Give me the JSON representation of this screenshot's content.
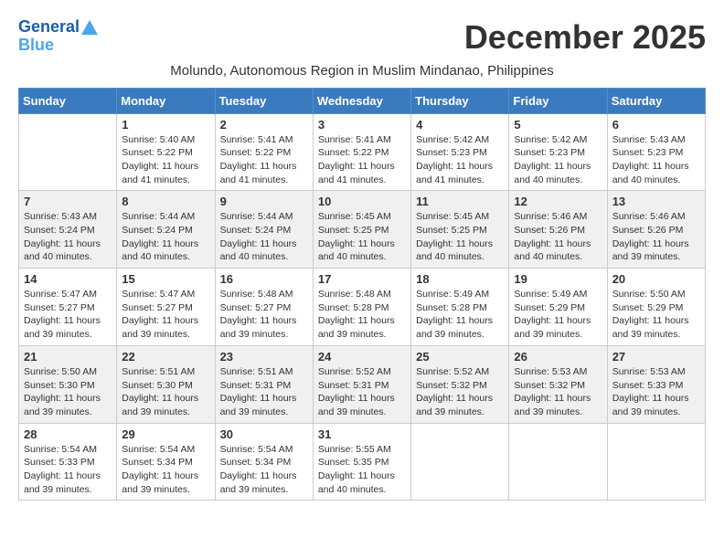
{
  "logo": {
    "line1": "General",
    "line2": "Blue"
  },
  "header": {
    "month_year": "December 2025",
    "location": "Molundo, Autonomous Region in Muslim Mindanao, Philippines"
  },
  "weekdays": [
    "Sunday",
    "Monday",
    "Tuesday",
    "Wednesday",
    "Thursday",
    "Friday",
    "Saturday"
  ],
  "weeks": [
    [
      {
        "day": "",
        "sunrise": "",
        "sunset": "",
        "daylight": ""
      },
      {
        "day": "1",
        "sunrise": "Sunrise: 5:40 AM",
        "sunset": "Sunset: 5:22 PM",
        "daylight": "Daylight: 11 hours and 41 minutes."
      },
      {
        "day": "2",
        "sunrise": "Sunrise: 5:41 AM",
        "sunset": "Sunset: 5:22 PM",
        "daylight": "Daylight: 11 hours and 41 minutes."
      },
      {
        "day": "3",
        "sunrise": "Sunrise: 5:41 AM",
        "sunset": "Sunset: 5:22 PM",
        "daylight": "Daylight: 11 hours and 41 minutes."
      },
      {
        "day": "4",
        "sunrise": "Sunrise: 5:42 AM",
        "sunset": "Sunset: 5:23 PM",
        "daylight": "Daylight: 11 hours and 41 minutes."
      },
      {
        "day": "5",
        "sunrise": "Sunrise: 5:42 AM",
        "sunset": "Sunset: 5:23 PM",
        "daylight": "Daylight: 11 hours and 40 minutes."
      },
      {
        "day": "6",
        "sunrise": "Sunrise: 5:43 AM",
        "sunset": "Sunset: 5:23 PM",
        "daylight": "Daylight: 11 hours and 40 minutes."
      }
    ],
    [
      {
        "day": "7",
        "sunrise": "Sunrise: 5:43 AM",
        "sunset": "Sunset: 5:24 PM",
        "daylight": "Daylight: 11 hours and 40 minutes."
      },
      {
        "day": "8",
        "sunrise": "Sunrise: 5:44 AM",
        "sunset": "Sunset: 5:24 PM",
        "daylight": "Daylight: 11 hours and 40 minutes."
      },
      {
        "day": "9",
        "sunrise": "Sunrise: 5:44 AM",
        "sunset": "Sunset: 5:24 PM",
        "daylight": "Daylight: 11 hours and 40 minutes."
      },
      {
        "day": "10",
        "sunrise": "Sunrise: 5:45 AM",
        "sunset": "Sunset: 5:25 PM",
        "daylight": "Daylight: 11 hours and 40 minutes."
      },
      {
        "day": "11",
        "sunrise": "Sunrise: 5:45 AM",
        "sunset": "Sunset: 5:25 PM",
        "daylight": "Daylight: 11 hours and 40 minutes."
      },
      {
        "day": "12",
        "sunrise": "Sunrise: 5:46 AM",
        "sunset": "Sunset: 5:26 PM",
        "daylight": "Daylight: 11 hours and 40 minutes."
      },
      {
        "day": "13",
        "sunrise": "Sunrise: 5:46 AM",
        "sunset": "Sunset: 5:26 PM",
        "daylight": "Daylight: 11 hours and 39 minutes."
      }
    ],
    [
      {
        "day": "14",
        "sunrise": "Sunrise: 5:47 AM",
        "sunset": "Sunset: 5:27 PM",
        "daylight": "Daylight: 11 hours and 39 minutes."
      },
      {
        "day": "15",
        "sunrise": "Sunrise: 5:47 AM",
        "sunset": "Sunset: 5:27 PM",
        "daylight": "Daylight: 11 hours and 39 minutes."
      },
      {
        "day": "16",
        "sunrise": "Sunrise: 5:48 AM",
        "sunset": "Sunset: 5:27 PM",
        "daylight": "Daylight: 11 hours and 39 minutes."
      },
      {
        "day": "17",
        "sunrise": "Sunrise: 5:48 AM",
        "sunset": "Sunset: 5:28 PM",
        "daylight": "Daylight: 11 hours and 39 minutes."
      },
      {
        "day": "18",
        "sunrise": "Sunrise: 5:49 AM",
        "sunset": "Sunset: 5:28 PM",
        "daylight": "Daylight: 11 hours and 39 minutes."
      },
      {
        "day": "19",
        "sunrise": "Sunrise: 5:49 AM",
        "sunset": "Sunset: 5:29 PM",
        "daylight": "Daylight: 11 hours and 39 minutes."
      },
      {
        "day": "20",
        "sunrise": "Sunrise: 5:50 AM",
        "sunset": "Sunset: 5:29 PM",
        "daylight": "Daylight: 11 hours and 39 minutes."
      }
    ],
    [
      {
        "day": "21",
        "sunrise": "Sunrise: 5:50 AM",
        "sunset": "Sunset: 5:30 PM",
        "daylight": "Daylight: 11 hours and 39 minutes."
      },
      {
        "day": "22",
        "sunrise": "Sunrise: 5:51 AM",
        "sunset": "Sunset: 5:30 PM",
        "daylight": "Daylight: 11 hours and 39 minutes."
      },
      {
        "day": "23",
        "sunrise": "Sunrise: 5:51 AM",
        "sunset": "Sunset: 5:31 PM",
        "daylight": "Daylight: 11 hours and 39 minutes."
      },
      {
        "day": "24",
        "sunrise": "Sunrise: 5:52 AM",
        "sunset": "Sunset: 5:31 PM",
        "daylight": "Daylight: 11 hours and 39 minutes."
      },
      {
        "day": "25",
        "sunrise": "Sunrise: 5:52 AM",
        "sunset": "Sunset: 5:32 PM",
        "daylight": "Daylight: 11 hours and 39 minutes."
      },
      {
        "day": "26",
        "sunrise": "Sunrise: 5:53 AM",
        "sunset": "Sunset: 5:32 PM",
        "daylight": "Daylight: 11 hours and 39 minutes."
      },
      {
        "day": "27",
        "sunrise": "Sunrise: 5:53 AM",
        "sunset": "Sunset: 5:33 PM",
        "daylight": "Daylight: 11 hours and 39 minutes."
      }
    ],
    [
      {
        "day": "28",
        "sunrise": "Sunrise: 5:54 AM",
        "sunset": "Sunset: 5:33 PM",
        "daylight": "Daylight: 11 hours and 39 minutes."
      },
      {
        "day": "29",
        "sunrise": "Sunrise: 5:54 AM",
        "sunset": "Sunset: 5:34 PM",
        "daylight": "Daylight: 11 hours and 39 minutes."
      },
      {
        "day": "30",
        "sunrise": "Sunrise: 5:54 AM",
        "sunset": "Sunset: 5:34 PM",
        "daylight": "Daylight: 11 hours and 39 minutes."
      },
      {
        "day": "31",
        "sunrise": "Sunrise: 5:55 AM",
        "sunset": "Sunset: 5:35 PM",
        "daylight": "Daylight: 11 hours and 40 minutes."
      },
      {
        "day": "",
        "sunrise": "",
        "sunset": "",
        "daylight": ""
      },
      {
        "day": "",
        "sunrise": "",
        "sunset": "",
        "daylight": ""
      },
      {
        "day": "",
        "sunrise": "",
        "sunset": "",
        "daylight": ""
      }
    ]
  ]
}
